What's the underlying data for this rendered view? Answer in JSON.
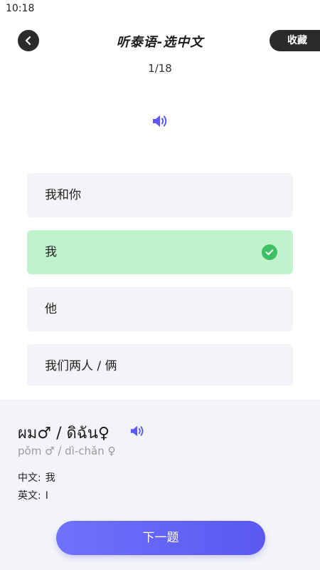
{
  "status_bar": {
    "time": "10:18"
  },
  "header": {
    "title": "听泰语-选中文",
    "favorite_label": "收藏"
  },
  "progress": "1/18",
  "options": [
    {
      "label": "我和你",
      "state": "default"
    },
    {
      "label": "我",
      "state": "correct"
    },
    {
      "label": "他",
      "state": "default"
    },
    {
      "label": "我们两人 / 俩",
      "state": "default"
    }
  ],
  "detail": {
    "thai_word": "ผม♂ / ดิฉัน♀",
    "romanization": "pǒm ♂ / dì-chǎn ♀",
    "chinese_label": "中文:",
    "chinese_value": "我",
    "english_label": "英文:",
    "english_value": "I"
  },
  "next_button_label": "下一题",
  "colors": {
    "accent": "#5a58f1",
    "correct_bg": "#c0f3cd",
    "correct_check": "#3fbf63",
    "option_bg": "#f3f4f7",
    "dark_button": "#2b2b2b"
  },
  "icons": [
    "back-arrow-icon",
    "speaker-icon",
    "check-icon"
  ]
}
